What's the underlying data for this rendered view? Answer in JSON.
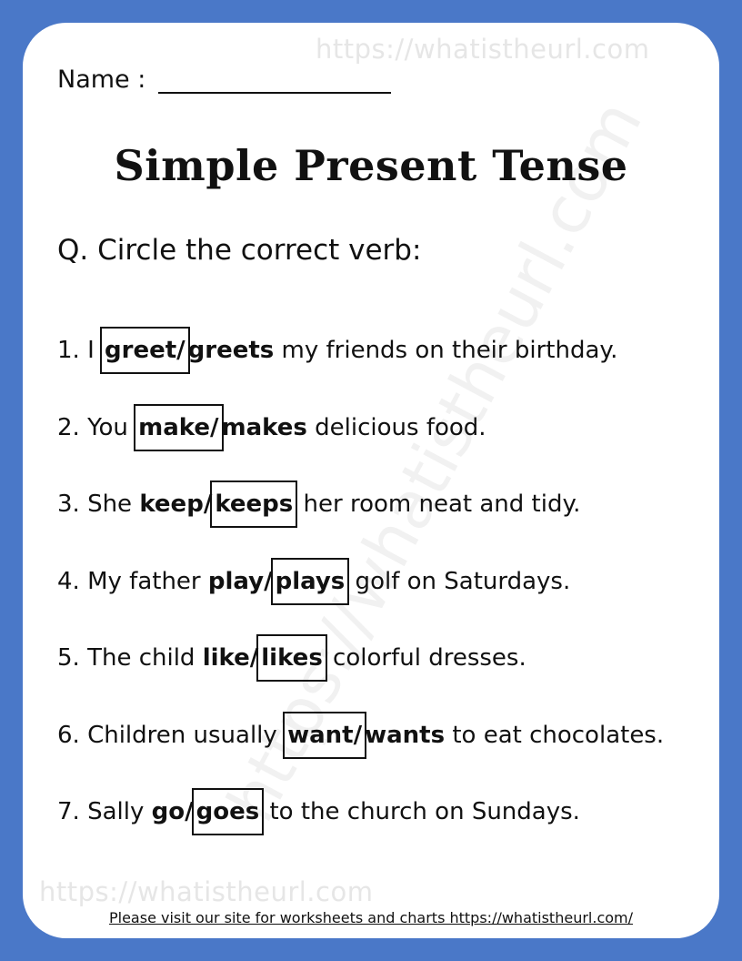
{
  "watermark": {
    "top": "https://whatistheurl.com",
    "bottom": "https://whatistheurl.com",
    "diagonal": "https://whatistheurl.com"
  },
  "name_label": "Name :",
  "title": "Simple Present Tense",
  "question": "Q. Circle the correct verb:",
  "items": [
    {
      "num": "1.",
      "before": "I ",
      "opt1": "greet",
      "sep": "/",
      "opt2": "greets",
      "after": " my friends on their birthday.",
      "circled": 1
    },
    {
      "num": "2.",
      "before": "You ",
      "opt1": "make",
      "sep": "/",
      "opt2": "makes",
      "after": " delicious food.",
      "circled": 1
    },
    {
      "num": "3.",
      "before": "She ",
      "opt1": "keep",
      "sep": "/",
      "opt2": "keeps",
      "after": " her room neat and tidy.",
      "circled": 2
    },
    {
      "num": "4.",
      "before": "My father ",
      "opt1": "play",
      "sep": "/",
      "opt2": "plays",
      "after": " golf on Saturdays.",
      "circled": 2
    },
    {
      "num": "5.",
      "before": "The child ",
      "opt1": "like",
      "sep": "/",
      "opt2": "likes",
      "after": " colorful dresses.",
      "circled": 2
    },
    {
      "num": "6.",
      "before": "Children usually ",
      "opt1": "want",
      "sep": "/",
      "opt2": "wants",
      "after": " to eat chocolates.",
      "circled": 1
    },
    {
      "num": "7.",
      "before": "Sally ",
      "opt1": "go",
      "sep": "/",
      "opt2": "goes",
      "after": " to the church on Sundays.",
      "circled": 2
    }
  ],
  "footer": "Please visit our site for worksheets and charts https://whatistheurl.com/",
  "colors": {
    "border": "#4a78c8",
    "paper": "#ffffff",
    "watermark": "#e6e6e6",
    "text": "#111111"
  }
}
